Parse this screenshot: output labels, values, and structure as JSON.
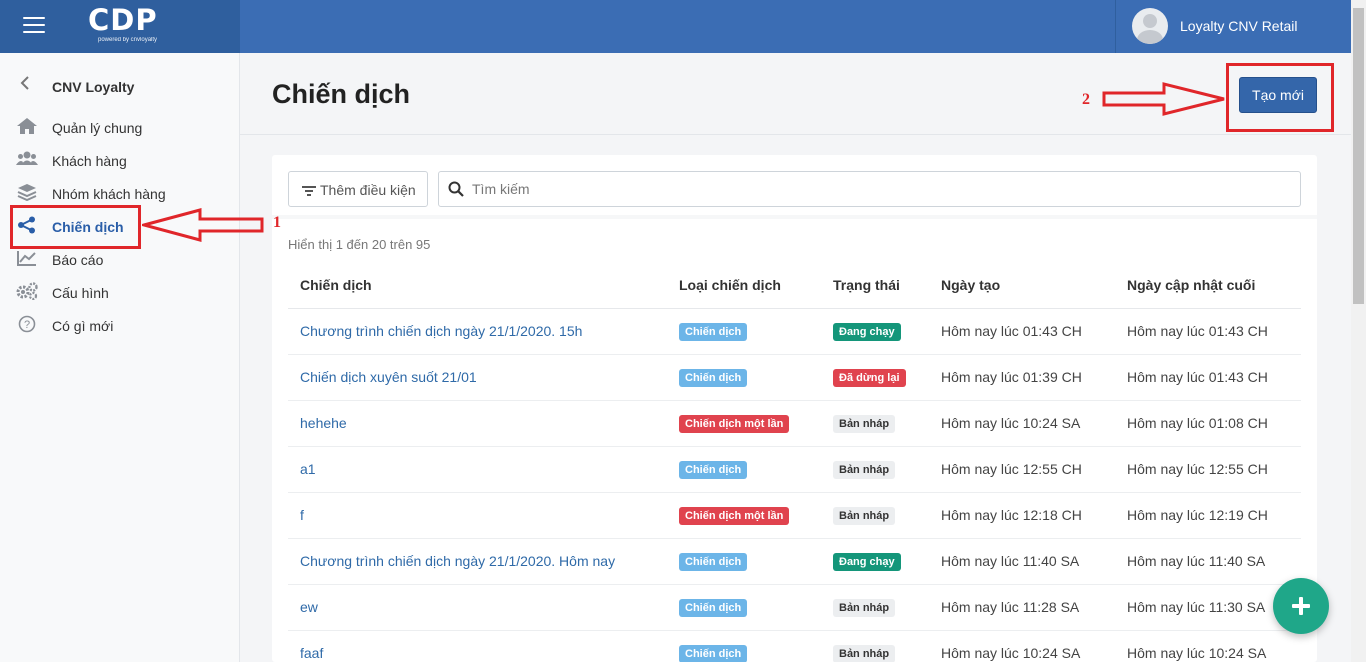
{
  "topbar": {
    "logo": "CDP",
    "logo_sub": "powered by cnvloyalty",
    "user_name": "Loyalty CNV Retail"
  },
  "sidebar": {
    "title": "CNV Loyalty",
    "items": [
      {
        "label": "Quản lý chung",
        "icon": "home-icon"
      },
      {
        "label": "Khách hàng",
        "icon": "users-icon"
      },
      {
        "label": "Nhóm khách hàng",
        "icon": "layers-icon"
      },
      {
        "label": "Chiến dịch",
        "icon": "share-icon",
        "active": true
      },
      {
        "label": "Báo cáo",
        "icon": "chart-icon"
      },
      {
        "label": "Cấu hình",
        "icon": "gears-icon"
      },
      {
        "label": "Có gì mới",
        "icon": "question-icon"
      }
    ]
  },
  "page": {
    "title": "Chiến dịch",
    "create_button": "Tạo mới"
  },
  "filter": {
    "add_condition": "Thêm điều kiện",
    "search_placeholder": "Tìm kiếm"
  },
  "table": {
    "showing": "Hiển thị 1 đến 20 trên 95",
    "headers": [
      "Chiến dịch",
      "Loại chiến dịch",
      "Trạng thái",
      "Ngày tạo",
      "Ngày cập nhật cuối"
    ],
    "rows": [
      {
        "name": "Chương trình chiến dịch ngày 21/1/2020. 15h",
        "type": "Chiến dịch",
        "type_kind": "info",
        "status": "Đang chạy",
        "status_kind": "success",
        "created": "Hôm nay lúc 01:43 CH",
        "updated": "Hôm nay lúc 01:43 CH"
      },
      {
        "name": "Chiến dịch xuyên suốt 21/01",
        "type": "Chiến dịch",
        "type_kind": "info",
        "status": "Đã dừng lại",
        "status_kind": "danger",
        "created": "Hôm nay lúc 01:39 CH",
        "updated": "Hôm nay lúc 01:43 CH"
      },
      {
        "name": "hehehe",
        "type": "Chiến dịch một lần",
        "type_kind": "danger",
        "status": "Bản nháp",
        "status_kind": "draft",
        "created": "Hôm nay lúc 10:24 SA",
        "updated": "Hôm nay lúc 01:08 CH"
      },
      {
        "name": "a1",
        "type": "Chiến dịch",
        "type_kind": "info",
        "status": "Bản nháp",
        "status_kind": "draft",
        "created": "Hôm nay lúc 12:55 CH",
        "updated": "Hôm nay lúc 12:55 CH"
      },
      {
        "name": "f",
        "type": "Chiến dịch một lần",
        "type_kind": "danger",
        "status": "Bản nháp",
        "status_kind": "draft",
        "created": "Hôm nay lúc 12:18 CH",
        "updated": "Hôm nay lúc 12:19 CH"
      },
      {
        "name": "Chương trình chiến dịch ngày 21/1/2020. Hôm nay",
        "type": "Chiến dịch",
        "type_kind": "info",
        "status": "Đang chạy",
        "status_kind": "success",
        "created": "Hôm nay lúc 11:40 SA",
        "updated": "Hôm nay lúc 11:40 SA"
      },
      {
        "name": "ew",
        "type": "Chiến dịch",
        "type_kind": "info",
        "status": "Bản nháp",
        "status_kind": "draft",
        "created": "Hôm nay lúc 11:28 SA",
        "updated": "Hôm nay lúc 11:30 SA"
      },
      {
        "name": "faaf",
        "type": "Chiến dịch",
        "type_kind": "info",
        "status": "Bản nháp",
        "status_kind": "draft",
        "created": "Hôm nay lúc 10:24 SA",
        "updated": "Hôm nay lúc 10:24 SA"
      }
    ]
  },
  "annotations": {
    "label_1": "1",
    "label_2": "2"
  },
  "colors": {
    "topbar": "#3b6db4",
    "brand_block": "#2f5f9e",
    "primary_button": "#3466aa",
    "link": "#2f6aa8",
    "badge_info": "#6cb5e8",
    "badge_success": "#14967a",
    "badge_danger": "#e0434e",
    "badge_draft": "#eceef0",
    "fab": "#1fa789",
    "annotation": "#e0262a"
  }
}
